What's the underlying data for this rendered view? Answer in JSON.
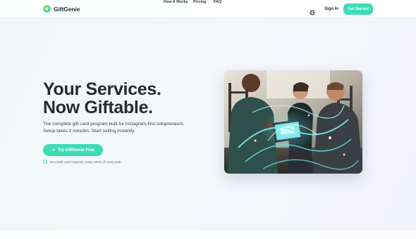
{
  "nav": {
    "brand": "GiftGenie",
    "links": [
      "How It Works",
      "Pricing",
      "FAQ"
    ],
    "sign_in": "Sign In",
    "cta": "Get Started",
    "language_icon": "globe-icon"
  },
  "hero": {
    "headline_line1": "Your Services.",
    "headline_line2": "Now Giftable.",
    "subheadline": "The complete gift card program built for Instagram-first solopreneurs. Setup takes 2 minutes. Start selling instantly.",
    "cta_icon": "sparkle-icon",
    "cta": "Try GiftGenie Free",
    "note_icon": "check-circle-icon",
    "note": "No credit card required. Keep 100% of every sale."
  },
  "image": {
    "subject": "Three people in a gym looking at a tablet surrounded by glowing teal swirls"
  },
  "colors": {
    "accent": "#3ddbb8",
    "text": "#242d2d",
    "background_start": "#eef8f6",
    "background_end": "#f3f3fa"
  }
}
